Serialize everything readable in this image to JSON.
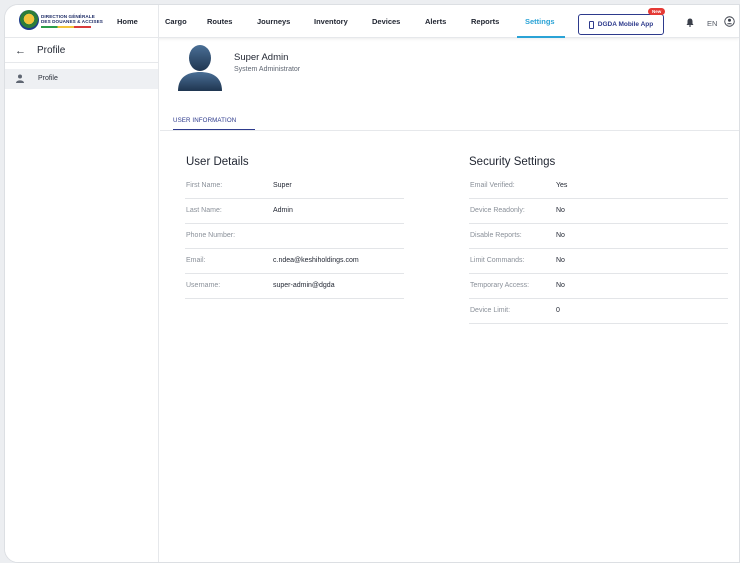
{
  "logo": {
    "line1": "DIRECTION GÉNÉRALE",
    "line2": "DES DOUANES & ACCISES"
  },
  "nav": {
    "items": [
      "Home",
      "Cargo",
      "Routes",
      "Journeys",
      "Inventory",
      "Devices",
      "Alerts",
      "Reports",
      "Settings"
    ],
    "active": "Settings",
    "mobile_app_label": "DGDA Mobile App",
    "new_badge": "New",
    "language": "EN"
  },
  "sidebar": {
    "title": "Profile",
    "items": [
      {
        "label": "Profile"
      }
    ]
  },
  "profile": {
    "name": "Super Admin",
    "role": "System Administrator"
  },
  "tabs": [
    {
      "label": "USER INFORMATION",
      "active": true
    }
  ],
  "user_details": {
    "title": "User Details",
    "rows": [
      {
        "label": "First Name:",
        "value": "Super"
      },
      {
        "label": "Last Name:",
        "value": "Admin"
      },
      {
        "label": "Phone Number:",
        "value": ""
      },
      {
        "label": "Email:",
        "value": "c.ndea@keshiholdings.com"
      },
      {
        "label": "Username:",
        "value": "super-admin@dgda"
      }
    ]
  },
  "security_settings": {
    "title": "Security Settings",
    "rows": [
      {
        "label": "Email Verified:",
        "value": "Yes"
      },
      {
        "label": "Device Readonly:",
        "value": "No"
      },
      {
        "label": "Disable Reports:",
        "value": "No"
      },
      {
        "label": "Limit Commands:",
        "value": "No"
      },
      {
        "label": "Temporary Access:",
        "value": "No"
      },
      {
        "label": "Device Limit:",
        "value": "0"
      }
    ]
  },
  "colors": {
    "accent": "#2aa3d6",
    "primary": "#2d3a8c",
    "badge": "#e53935"
  }
}
